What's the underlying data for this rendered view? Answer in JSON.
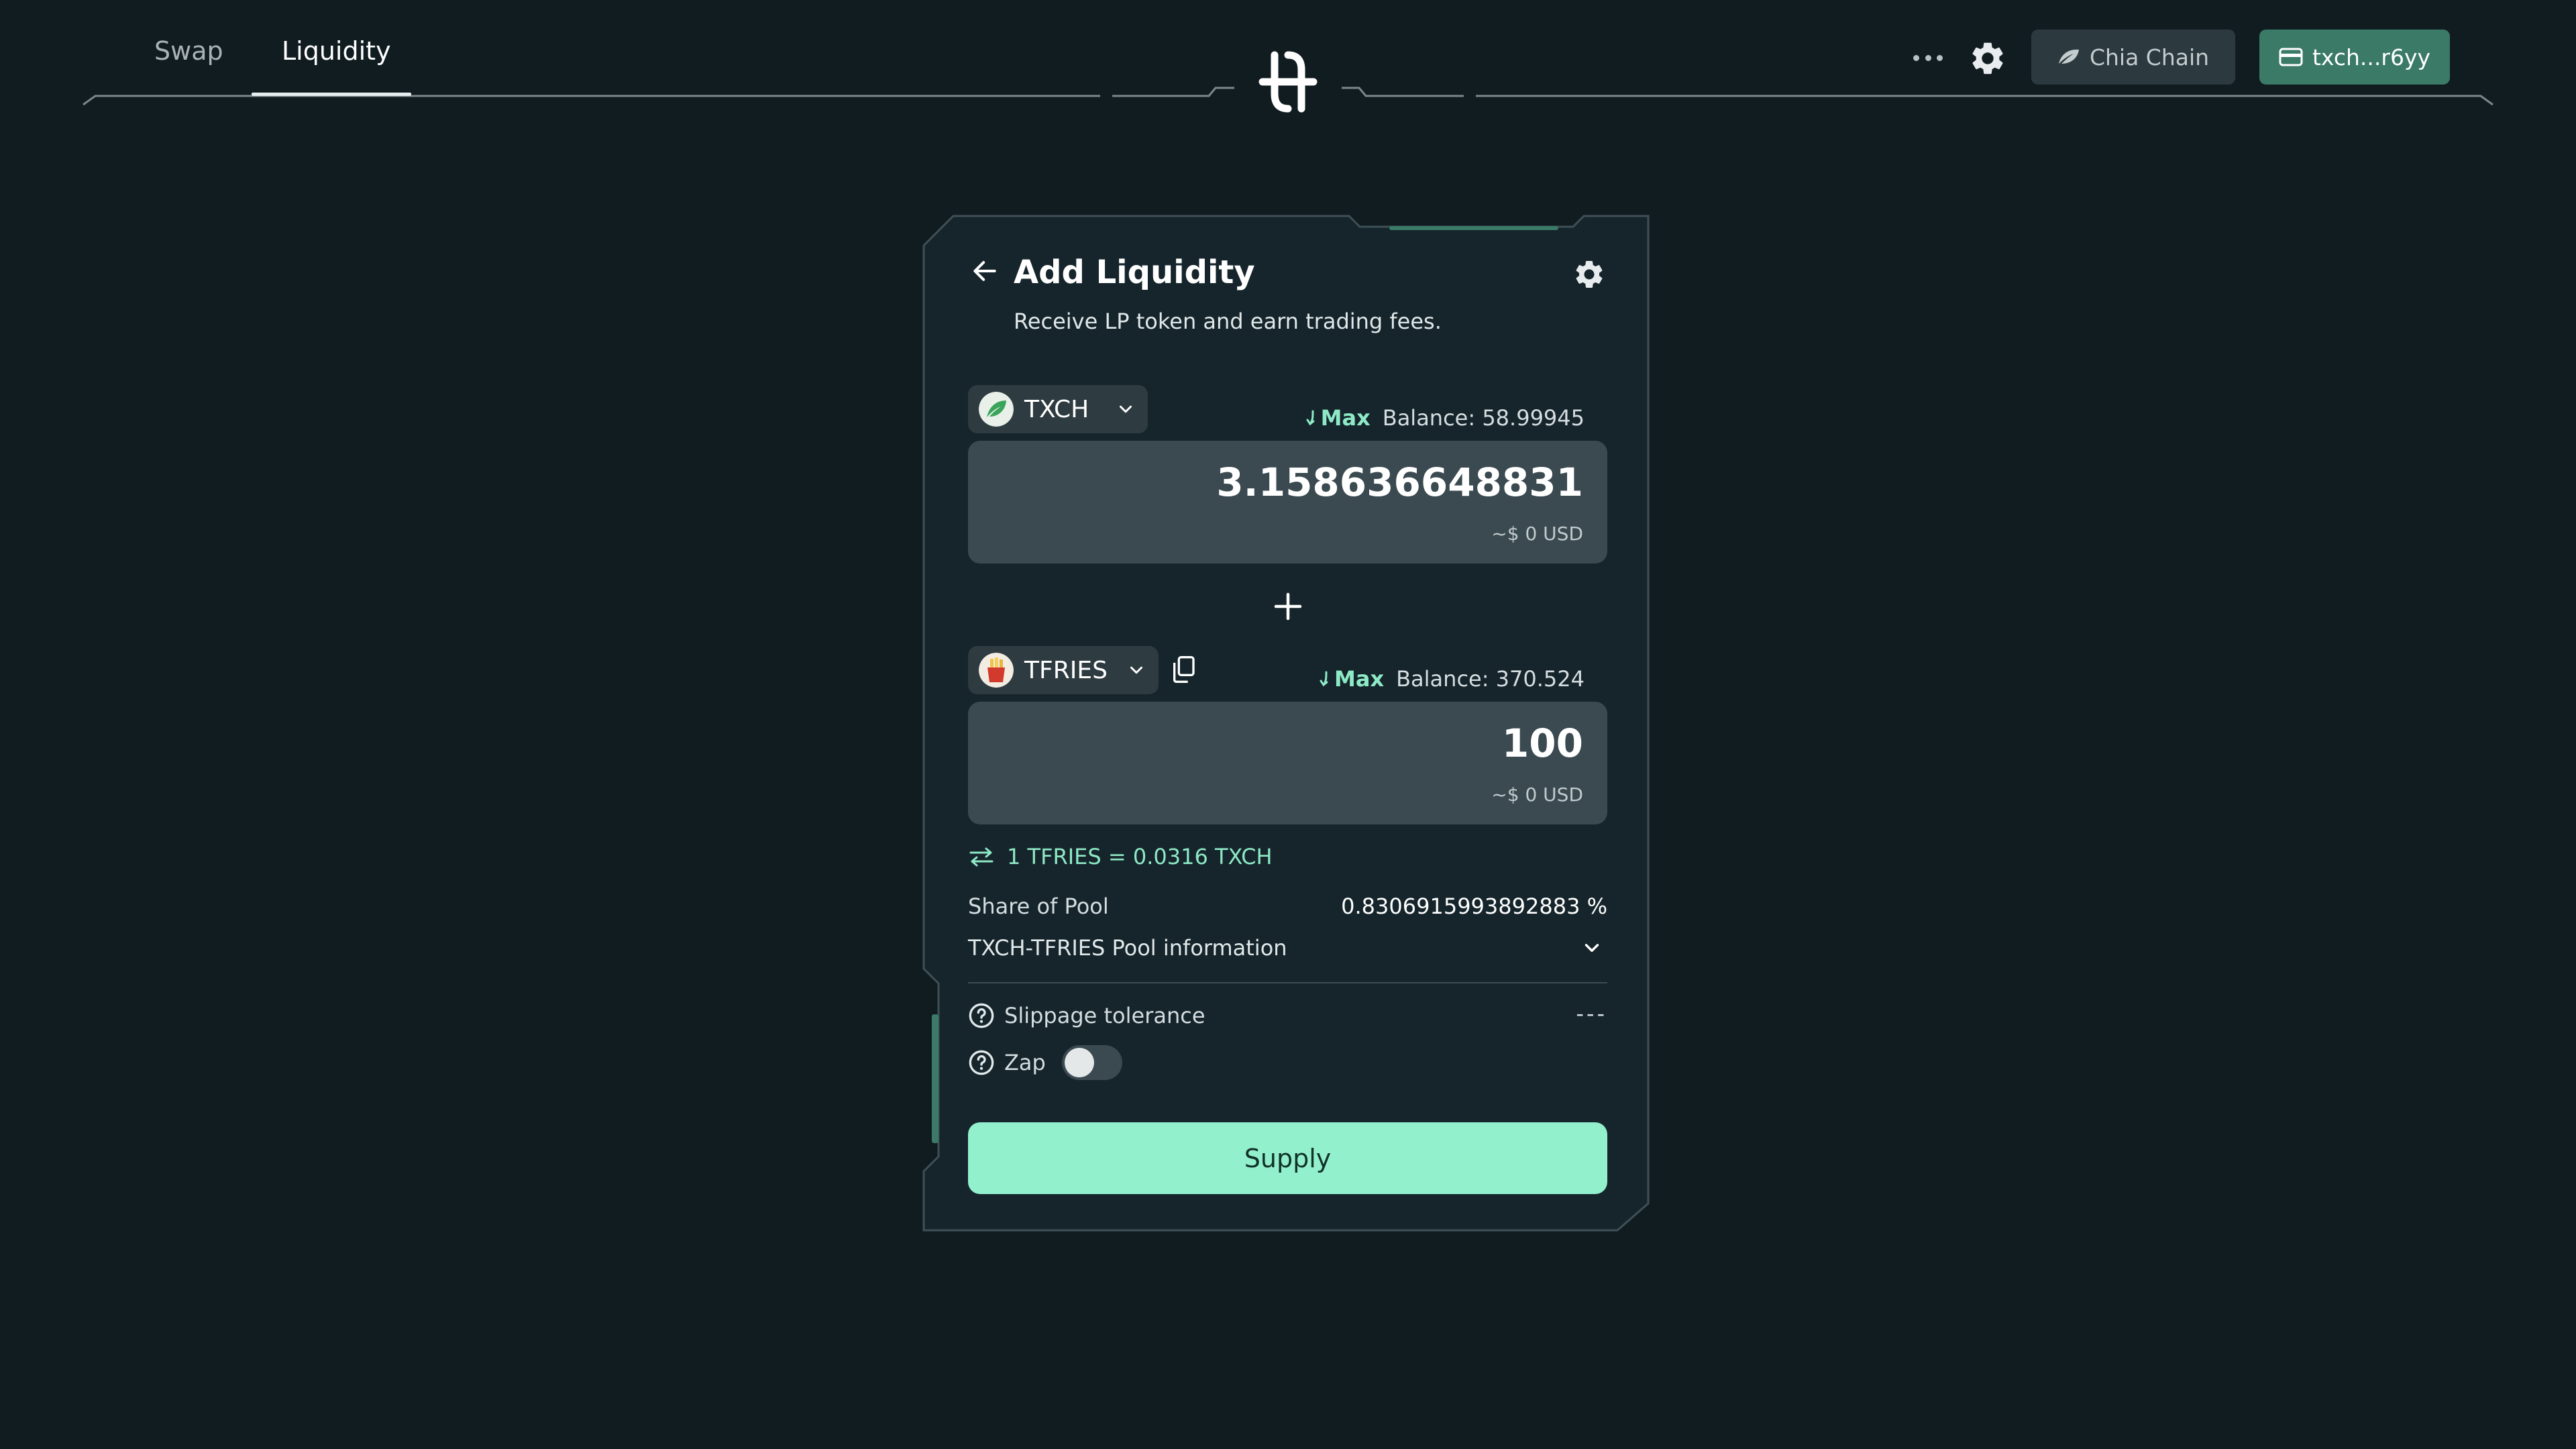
{
  "nav": {
    "tabs": [
      {
        "label": "Swap",
        "active": false
      },
      {
        "label": "Liquidity",
        "active": true
      }
    ]
  },
  "header": {
    "chain_label": "Chia Chain",
    "wallet_label": "txch...r6yy",
    "icons": [
      "more-icon",
      "settings-icon",
      "leaf-icon",
      "wallet-icon",
      "logo"
    ]
  },
  "card": {
    "title": "Add Liquidity",
    "subtitle": "Receive LP token and earn trading fees.",
    "token_a": {
      "symbol": "TXCH",
      "max_label": "Max",
      "balance_label": "Balance: 58.99945",
      "amount": "3.158636648831",
      "usd": "~$ 0 USD"
    },
    "token_b": {
      "symbol": "TFRIES",
      "max_label": "Max",
      "balance_label": "Balance: 370.524",
      "amount": "100",
      "usd": "~$ 0 USD"
    },
    "rate": "1 TFRIES = 0.0316 TXCH",
    "share_label": "Share of Pool",
    "share_value": "0.8306915993892883 %",
    "pool_info_label": "TXCH-TFRIES Pool information",
    "slippage_label": "Slippage tolerance",
    "slippage_value": "---",
    "zap_label": "Zap",
    "zap_enabled": false,
    "supply_label": "Supply"
  },
  "colors": {
    "background": "#111c21",
    "card": "#15252b",
    "accent": "#93f0cd",
    "accent_text": "#8ee9c6",
    "wallet_button": "#3a7a66",
    "input_bg": "#3a4a50"
  }
}
